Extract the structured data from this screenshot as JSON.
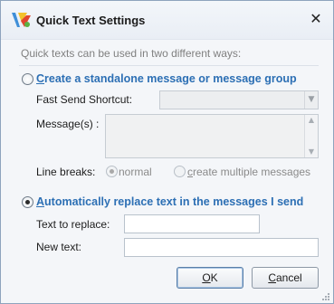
{
  "window": {
    "title": "Quick Text Settings",
    "close_glyph": "✕"
  },
  "intro_text": "Quick texts can be used in two different ways:",
  "option_standalone": {
    "label_first": "C",
    "label_rest": "reate a standalone message or message group",
    "selected": false,
    "fast_send_label": "Fast Send Shortcut:",
    "fast_send_value": "",
    "messages_label": "Message(s) :",
    "messages_value": "",
    "line_breaks_label": "Line breaks:",
    "line_break_options": [
      {
        "label": "normal",
        "selected": true
      },
      {
        "label_first": "c",
        "label_rest": "reate multiple messages",
        "selected": false
      }
    ]
  },
  "option_replace": {
    "label_first": "A",
    "label_rest": "utomatically replace text in the messages I send",
    "selected": true,
    "text_to_replace_label": "Text to replace:",
    "text_to_replace_value": "",
    "new_text_label": "New text:",
    "new_text_value": ""
  },
  "buttons": {
    "ok_first": "O",
    "ok_rest": "K",
    "cancel_first": "C",
    "cancel_rest": "ancel"
  },
  "colors": {
    "accent_link": "#2c6fb4",
    "window_bg": "#f4f6f9",
    "border": "#8ea3bd"
  },
  "icons": {
    "app": "app-logo-icon",
    "close": "close-icon",
    "dropdown": "chevron-down-icon",
    "scroll_up": "chevron-up-icon",
    "scroll_down": "chevron-down-icon",
    "resize": "resize-grip-icon"
  }
}
